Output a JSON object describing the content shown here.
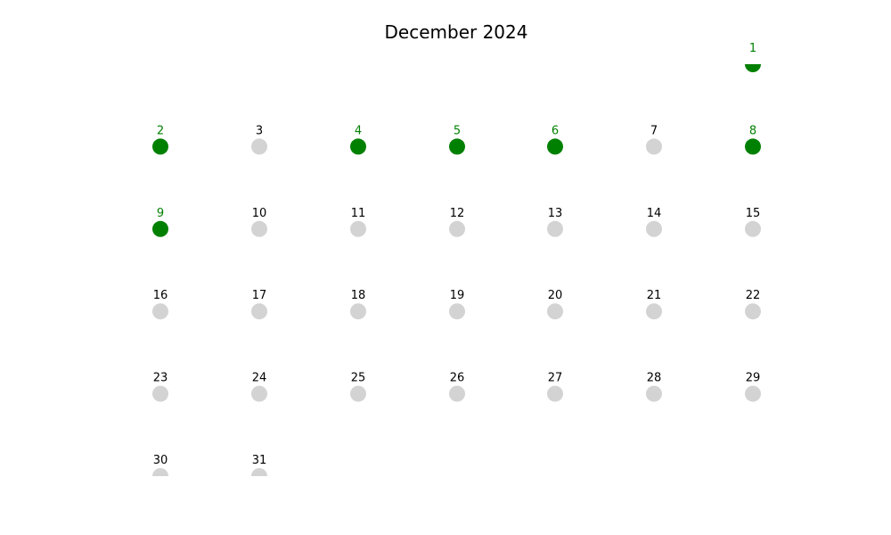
{
  "calendar": {
    "title": "December 2024",
    "month": "December",
    "year": 2024
  },
  "colors": {
    "active": "#008000",
    "inactive": "#d3d3d3",
    "label_default": "#000000"
  },
  "chart_data": {
    "type": "scatter",
    "title": "December 2024",
    "xlabel": "",
    "ylabel": "",
    "grid": false,
    "columns": 7,
    "first_weekday_column": 6,
    "days": [
      {
        "day": 1,
        "active": true
      },
      {
        "day": 2,
        "active": true
      },
      {
        "day": 3,
        "active": false
      },
      {
        "day": 4,
        "active": true
      },
      {
        "day": 5,
        "active": true
      },
      {
        "day": 6,
        "active": true
      },
      {
        "day": 7,
        "active": false
      },
      {
        "day": 8,
        "active": true
      },
      {
        "day": 9,
        "active": true
      },
      {
        "day": 10,
        "active": false
      },
      {
        "day": 11,
        "active": false
      },
      {
        "day": 12,
        "active": false
      },
      {
        "day": 13,
        "active": false
      },
      {
        "day": 14,
        "active": false
      },
      {
        "day": 15,
        "active": false
      },
      {
        "day": 16,
        "active": false
      },
      {
        "day": 17,
        "active": false
      },
      {
        "day": 18,
        "active": false
      },
      {
        "day": 19,
        "active": false
      },
      {
        "day": 20,
        "active": false
      },
      {
        "day": 21,
        "active": false
      },
      {
        "day": 22,
        "active": false
      },
      {
        "day": 23,
        "active": false
      },
      {
        "day": 24,
        "active": false
      },
      {
        "day": 25,
        "active": false
      },
      {
        "day": 26,
        "active": false
      },
      {
        "day": 27,
        "active": false
      },
      {
        "day": 28,
        "active": false
      },
      {
        "day": 29,
        "active": false
      },
      {
        "day": 30,
        "active": false
      },
      {
        "day": 31,
        "active": false
      }
    ]
  }
}
